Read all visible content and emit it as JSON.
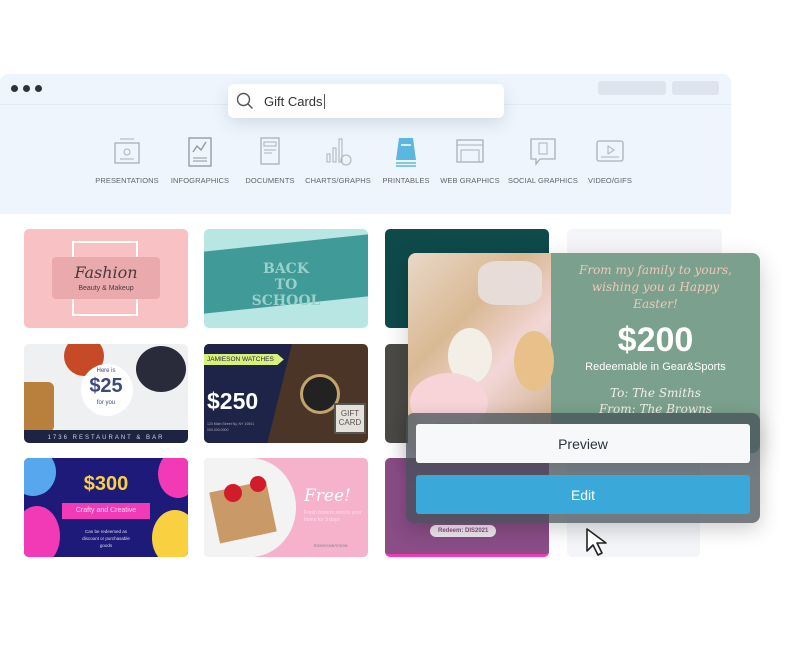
{
  "window": {
    "dots": 3
  },
  "search": {
    "value": "Gift Cards",
    "icon": "search-icon"
  },
  "categories": [
    {
      "label": "PRESENTATIONS",
      "icon": "presentation-icon"
    },
    {
      "label": "INFOGRAPHICS",
      "icon": "infographic-icon"
    },
    {
      "label": "DOCUMENTS",
      "icon": "document-icon"
    },
    {
      "label": "CHARTS/GRAPHS",
      "icon": "chart-icon"
    },
    {
      "label": "PRINTABLES",
      "icon": "printable-icon",
      "active": true
    },
    {
      "label": "WEB GRAPHICS",
      "icon": "web-graphic-icon"
    },
    {
      "label": "SOCIAL GRAPHICS",
      "icon": "social-graphic-icon"
    },
    {
      "label": "VIDEO/GIFS",
      "icon": "video-icon"
    }
  ],
  "templates": {
    "fashion": {
      "title": "Fashion",
      "subtitle": "Beauty & Makeup"
    },
    "school": {
      "title": "BACK TO SCHOOL"
    },
    "restaurant": {
      "pre": "Here is",
      "amount": "$25",
      "post": "for you",
      "footer": "1736 RESTAURANT & BAR"
    },
    "watches": {
      "brand": "JAMIESON WATCHES",
      "amount": "$250",
      "address": "123 Main Street Ny, NY 10001",
      "phone": "000.000.0000",
      "badge": "GIFT CARD"
    },
    "crafty": {
      "amount": "$300",
      "banner": "Crafty and Creative",
      "note": "Can be redeemed as discount or purchasable goods"
    },
    "flowers": {
      "title": "Free!",
      "text": "Fresh flowers sent to your home for 3 days",
      "brand": "Essence&Aroma"
    },
    "promo": {
      "code": "Redeem: DIS2021"
    }
  },
  "popup": {
    "message": "From my family to yours, wishing you a Happy Easter!",
    "amount": "$200",
    "redeem": "Redeemable in Gear&Sports",
    "to": "To: The Smiths",
    "from": "From: The Browns",
    "preview_label": "Preview",
    "edit_label": "Edit"
  },
  "colors": {
    "accent": "#3aa8d8",
    "popup_green": "#7ba08d",
    "window_bg": "#eef5fc"
  }
}
